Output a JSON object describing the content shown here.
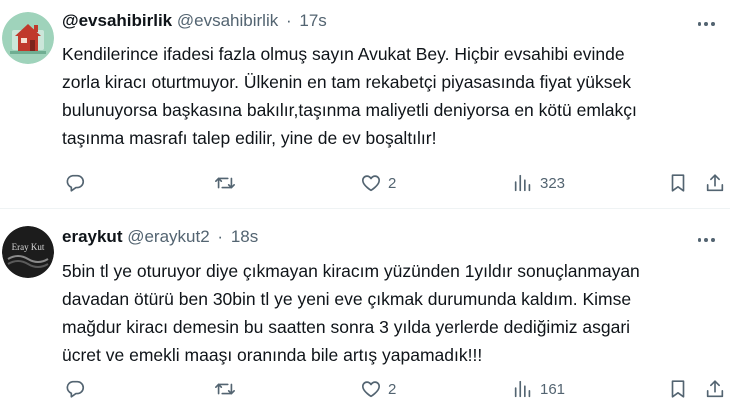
{
  "tweets": [
    {
      "display_name": "@evsahibirlik",
      "handle": "@evsahibirlik",
      "separator": "·",
      "time": "17s",
      "lines": [
        "Kendilerince ifadesi fazla olmuş sayın Avukat Bey. Hiçbir evsahibi evinde",
        "zorla kiracı oturtmuyor. Ülkenin en tam rekabetçi piyasasında fiyat yüksek",
        "bulunuyorsa başkasına bakılır,taşınma maliyetli deniyorsa en kötü emlakçı",
        "taşınma masrafı  talep edilir, yine de ev boşaltılır!"
      ],
      "reply_count": "",
      "retweet_count": "",
      "like_count": "2",
      "view_count": "323",
      "avatar_colors": {
        "bg": "#9fd3bb",
        "house": "#c0392b"
      }
    },
    {
      "display_name": "eraykut",
      "handle": "@eraykut2",
      "separator": "·",
      "time": "18s",
      "avatar_text": "Eray Kut",
      "lines": [
        "5bin tl ye oturuyor diye çıkmayan kiracım yüzünden 1yıldır sonuçlanmayan",
        "davadan ötürü ben 30bin tl ye yeni eve çıkmak durumunda kaldım. Kimse",
        "mağdur kiracı demesin bu saatten sonra 3 yılda yerlerde dediğimiz asgari",
        "ücret ve emekli maaşı oranında bile artış yapamadık!!!"
      ],
      "reply_count": "",
      "retweet_count": "",
      "like_count": "2",
      "view_count": "161",
      "avatar_colors": {
        "bg": "#1c1c1c",
        "text": "#d9d9d9"
      }
    }
  ],
  "icons": {
    "reply": "reply-icon",
    "retweet": "retweet-icon",
    "like": "heart-icon",
    "views": "views-icon",
    "bookmark": "bookmark-icon",
    "share": "share-icon",
    "more": "more-icon"
  },
  "colors": {
    "text": "#0f1419",
    "secondary": "#536471",
    "divider": "#eff3f4"
  }
}
